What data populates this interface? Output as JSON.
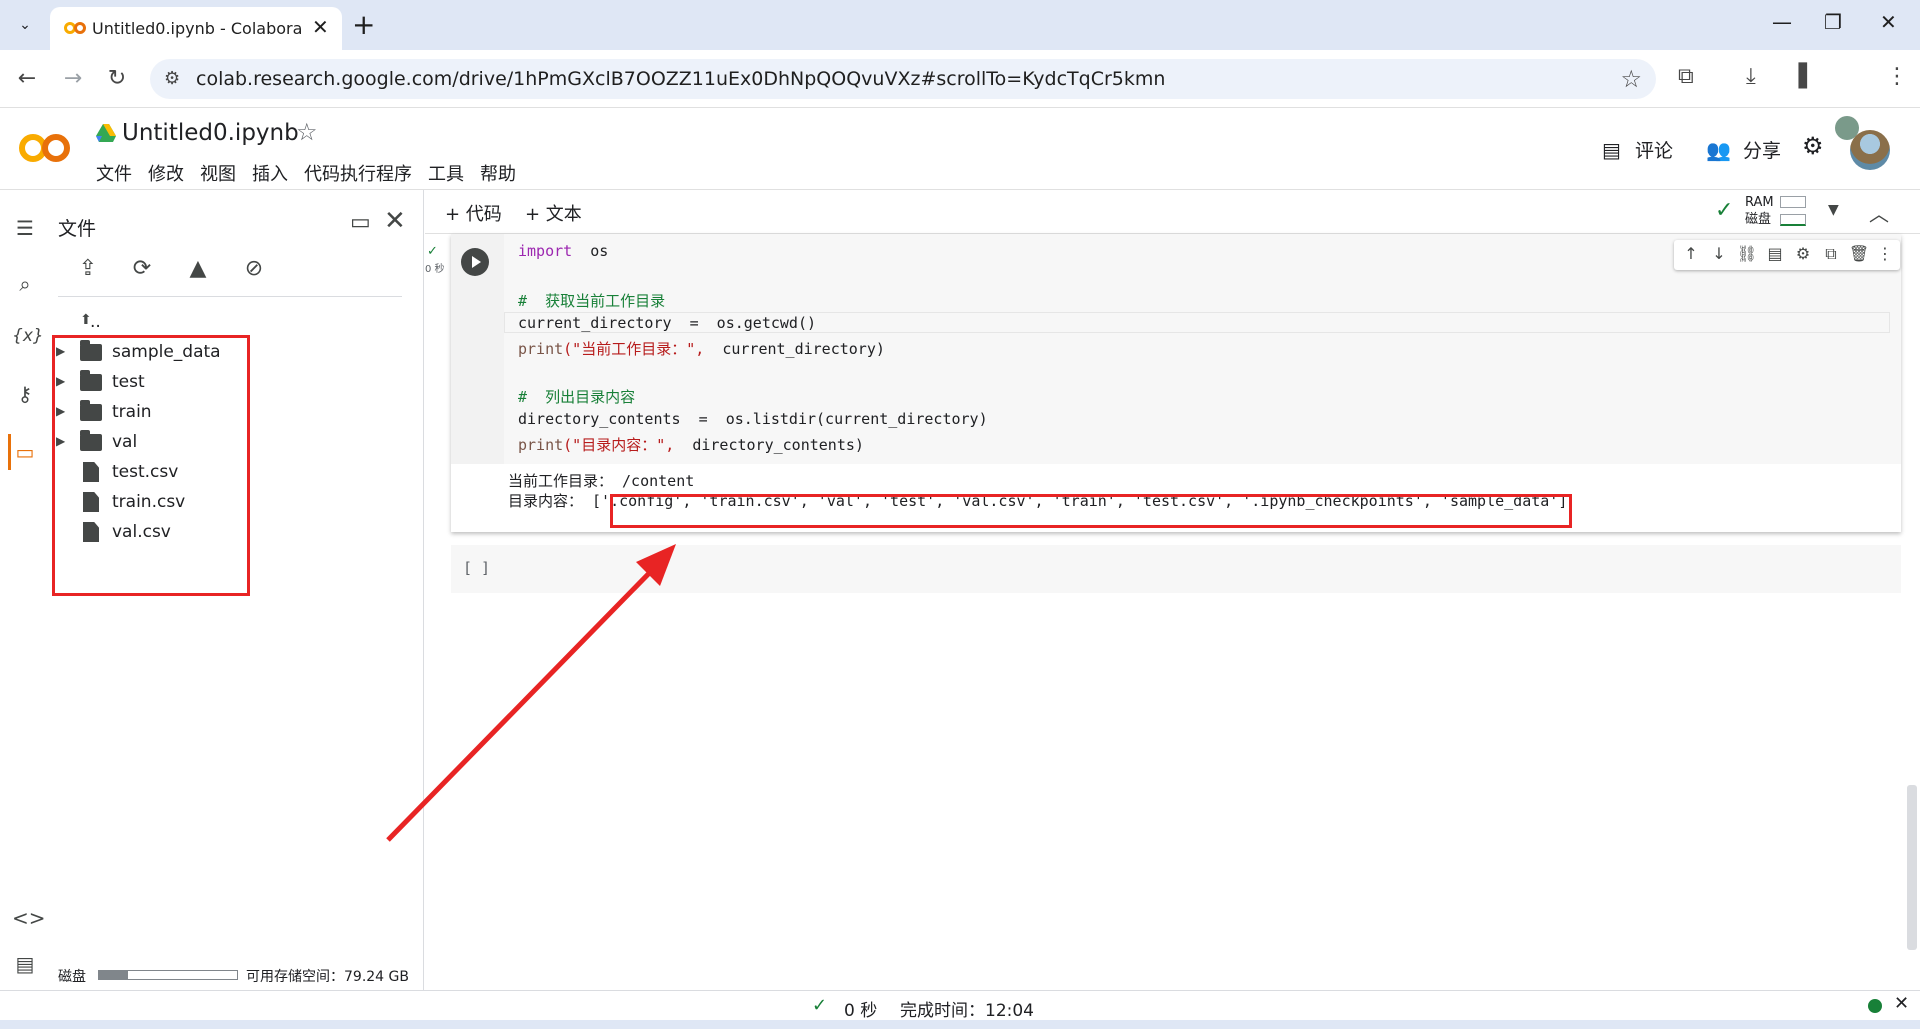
{
  "browser": {
    "tab_title": "Untitled0.ipynb - Colaboratory",
    "tab_close": "✕",
    "new_tab": "+",
    "url": "colab.research.google.com/drive/1hPmGXclB7OOZZ11uEx0DhNpQOQvuVXz#scrollTo=KydcTqCr5kmn",
    "icons": [
      "back-icon",
      "forward-icon",
      "reload-icon",
      "site-info-icon",
      "bookmark-star-icon",
      "extensions-icon",
      "download-icon",
      "sidepanel-icon",
      "profile-icon",
      "menu-icon"
    ]
  },
  "colab": {
    "notebook_title": "Untitled0.ipynb",
    "menu": [
      "文件",
      "修改",
      "视图",
      "插入",
      "代码执行程序",
      "工具",
      "帮助"
    ],
    "comment_label": "评论",
    "share_label": "分享"
  },
  "files_panel": {
    "title": "文件",
    "parent_dir": "..",
    "items": [
      {
        "name": "sample_data",
        "type": "folder"
      },
      {
        "name": "test",
        "type": "folder"
      },
      {
        "name": "train",
        "type": "folder"
      },
      {
        "name": "val",
        "type": "folder"
      },
      {
        "name": "test.csv",
        "type": "file"
      },
      {
        "name": "train.csv",
        "type": "file"
      },
      {
        "name": "val.csv",
        "type": "file"
      }
    ],
    "disk_label": "磁盘",
    "disk_used_fraction": 0.21,
    "available_text": "可用存储空间：79.24 GB"
  },
  "notebook_toolbar": {
    "add_code": "+ 代码",
    "add_text": "+ 文本",
    "ram_label": "RAM",
    "disk_label": "磁盘"
  },
  "cell": {
    "exec_time": "0 秒",
    "code": {
      "l1_kw": "import",
      "l1_rest": "  os",
      "l3": "#  获取当前工作目录",
      "l4": "current_directory  =  os.getcwd()",
      "l5_fn": "print",
      "l5_str": "(\"当前工作目录：\",",
      "l5_rest": "  current_directory)",
      "l7": "#  列出目录内容",
      "l8": "directory_contents  =  os.listdir(current_directory)",
      "l9_fn": "print",
      "l9_str": "(\"目录内容：\",",
      "l9_rest": "  directory_contents)"
    },
    "output": {
      "line1": "当前工作目录： /content",
      "line2": "目录内容： ['.config', 'train.csv', 'val', 'test', 'val.csv', 'train', 'test.csv', '.ipynb_checkpoints', 'sample_data']"
    }
  },
  "empty_cell": {
    "bracket": "[ ]"
  },
  "status": {
    "time": "0 秒",
    "completed": "完成时间：12:04"
  },
  "colors": {
    "highlight_red": "#e82424",
    "colab_orange": "#f9ab00",
    "ok_green": "#188038"
  }
}
